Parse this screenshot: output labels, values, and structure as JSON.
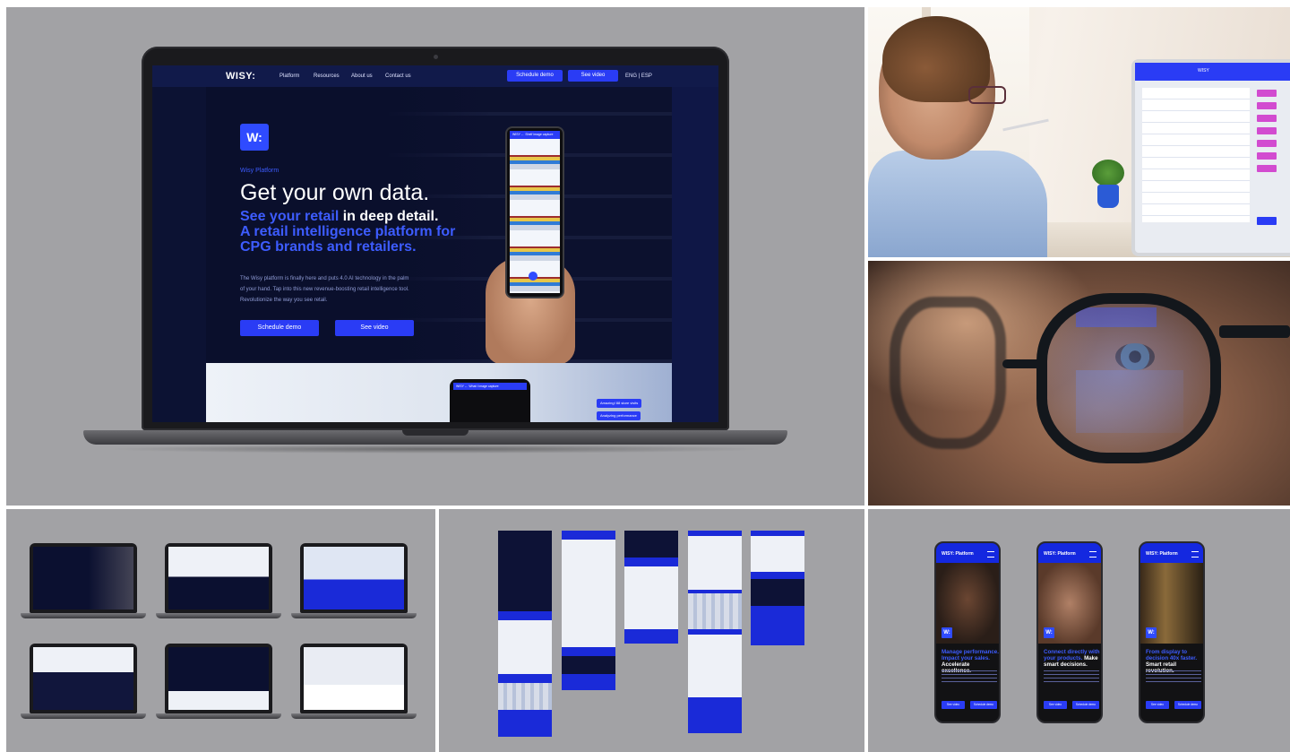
{
  "hero": {
    "nav": {
      "logo": "WISY:",
      "links": [
        "Platform",
        "Resources",
        "About us",
        "Contact us"
      ],
      "schedule_demo": "Schedule demo",
      "see_video": "See video",
      "lang": "ENG | ESP"
    },
    "mark": "W:",
    "eyebrow": "Wisy Platform",
    "headline": "Get your own data.",
    "sub_blue_1": "See your retail",
    "sub_white_1": " in deep detail.",
    "sub_blue_2": "A retail intelligence platform for CPG brands and retailers.",
    "body": "The Wisy platform is finally here and puts 4.0 AI technology in the palm of your hand. Tap into this new revenue-boosting retail intelligence tool. Revolutionize the way you see retail.",
    "cta_primary": "Schedule demo",
    "cta_secondary": "See video",
    "phone_bar": "WISY  ←  Shelf image capture",
    "lower_phone_bar": "WISY  ←  What I image capture",
    "lower_chips": [
      "Amazing! 88 store visits",
      "Analyzing performance"
    ]
  },
  "office": {
    "monitor_header": "WISY"
  },
  "mobile": [
    {
      "logo": "WISY:  Platform",
      "mark": "W:",
      "h_blue": "Manage performance. Impact your sales.",
      "h_white": "Accelerate excellence.",
      "btn1": "See video",
      "btn2": "Schedule demo"
    },
    {
      "logo": "WISY:  Platform",
      "mark": "W:",
      "h_blue": "Connect directly with your products.",
      "h_white": "Make smart decisions.",
      "btn1": "See video",
      "btn2": "Schedule demo"
    },
    {
      "logo": "WISY:  Platform",
      "mark": "W:",
      "h_blue": "From display to decision 40x faster.",
      "h_white": "Smart retail revolution.",
      "btn1": "See video",
      "btn2": "Schedule demo"
    }
  ],
  "colors": {
    "brand_blue": "#2a3cf5",
    "panel_gray": "#a2a2a5",
    "dark_navy": "#0c1233"
  }
}
